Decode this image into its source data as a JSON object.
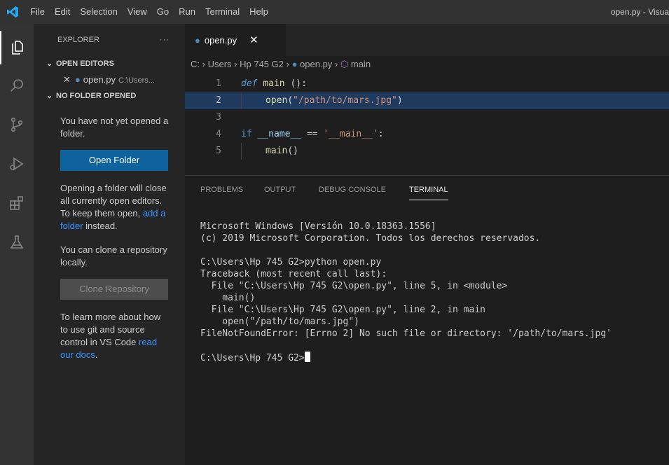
{
  "titlebar": {
    "menu": [
      "File",
      "Edit",
      "Selection",
      "View",
      "Go",
      "Run",
      "Terminal",
      "Help"
    ],
    "window_title": "open.py - Visua"
  },
  "activitybar": {
    "icons": [
      "explorer-icon",
      "search-icon",
      "source-control-icon",
      "run-debug-icon",
      "extensions-icon",
      "testing-icon"
    ]
  },
  "sidebar": {
    "title": "EXPLORER",
    "more": "···",
    "open_editors_label": "OPEN EDITORS",
    "open_editor_file": "open.py",
    "open_editor_path": "C:\\Users...",
    "no_folder_label": "NO FOLDER OPENED",
    "no_folder_text": "You have not yet opened a folder.",
    "open_folder_button": "Open Folder",
    "closing_text_1": "Opening a folder will close all currently open editors. To keep them open,",
    "add_folder_link_1": "add a",
    "add_folder_link_2": "folder",
    "closing_text_2": "instead.",
    "clone_text": "You can clone a repository locally.",
    "clone_button": "Clone Repository",
    "learn_text": "To learn more about how to use git and source control in VS Code",
    "docs_link": "read our docs",
    "docs_period": "."
  },
  "editor": {
    "tab_label": "open.py",
    "tab_close": "✕",
    "breadcrumb": [
      "C:",
      "Users",
      "Hp 745 G2",
      "open.py",
      "main"
    ],
    "line_numbers": [
      "1",
      "2",
      "3",
      "4",
      "5"
    ],
    "current_line": 2,
    "code": {
      "l1_def": "def",
      "l1_name": " main ",
      "l1_rest": "():",
      "l2_fn": "open",
      "l2_paren_open": "(",
      "l2_str": "\"/path/to/mars.jpg\"",
      "l2_paren_close": ")",
      "l4_if": "if",
      "l4_name": " __name__ ",
      "l4_eq": "== ",
      "l4_str": "'__main__'",
      "l4_colon": ":",
      "l5_fn": "main",
      "l5_rest": "()"
    }
  },
  "panel": {
    "tabs": [
      "PROBLEMS",
      "OUTPUT",
      "DEBUG CONSOLE",
      "TERMINAL"
    ],
    "active_tab": "TERMINAL",
    "terminal_lines": [
      "Microsoft Windows [Versión 10.0.18363.1556]",
      "(c) 2019 Microsoft Corporation. Todos los derechos reservados.",
      "",
      "C:\\Users\\Hp 745 G2>python open.py",
      "Traceback (most recent call last):",
      "  File \"C:\\Users\\Hp 745 G2\\open.py\", line 5, in <module>",
      "    main()",
      "  File \"C:\\Users\\Hp 745 G2\\open.py\", line 2, in main",
      "    open(\"/path/to/mars.jpg\")",
      "FileNotFoundError: [Errno 2] No such file or directory: '/path/to/mars.jpg'",
      ""
    ],
    "prompt": "C:\\Users\\Hp 745 G2>"
  },
  "colors": {
    "accent": "#0e639c",
    "link": "#3794ff",
    "vscode_blue": "#23a9f2"
  }
}
